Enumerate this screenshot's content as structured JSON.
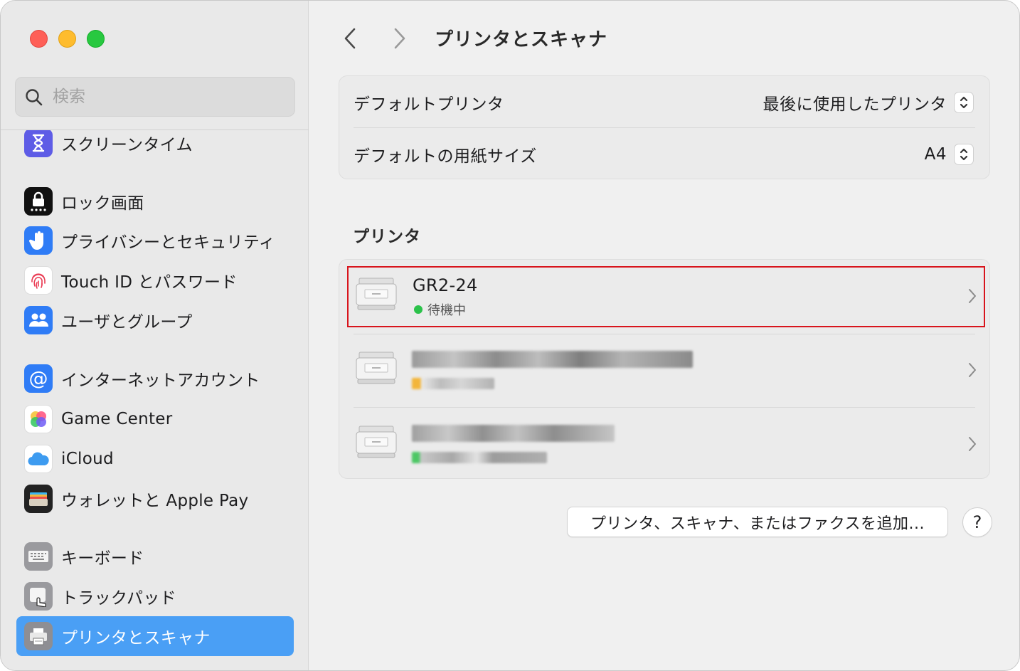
{
  "window": {
    "title": "プリンタとスキャナ"
  },
  "sidebar": {
    "search_placeholder": "検索",
    "items": [
      {
        "label": "スクリーンタイム",
        "icon": "hourglass-icon",
        "color": "#5e5ce6"
      },
      {
        "label": "ロック画面",
        "icon": "lock-screen-icon",
        "color": "#111111"
      },
      {
        "label": "プライバシーとセキュリティ",
        "icon": "hand-icon",
        "color": "#2f7cf6"
      },
      {
        "label": "Touch ID とパスワード",
        "icon": "fingerprint-icon",
        "color": "#ffffff"
      },
      {
        "label": "ユーザとグループ",
        "icon": "users-icon",
        "color": "#2f7cf6"
      },
      {
        "label": "インターネットアカウント",
        "icon": "at-icon",
        "color": "#2f7cf6"
      },
      {
        "label": "Game Center",
        "icon": "game-center-icon",
        "color": "#ffffff"
      },
      {
        "label": "iCloud",
        "icon": "cloud-icon",
        "color": "#ffffff"
      },
      {
        "label": "ウォレットと Apple Pay",
        "icon": "wallet-icon",
        "color": "#222222"
      },
      {
        "label": "キーボード",
        "icon": "keyboard-icon",
        "color": "#8e8e93"
      },
      {
        "label": "トラックパッド",
        "icon": "trackpad-icon",
        "color": "#8e8e93"
      },
      {
        "label": "プリンタとスキャナ",
        "icon": "printer-icon",
        "color": "#8e8e93",
        "selected": true
      }
    ]
  },
  "main": {
    "title": "プリンタとスキャナ",
    "defaults": [
      {
        "label": "デフォルトプリンタ",
        "value": "最後に使用したプリンタ"
      },
      {
        "label": "デフォルトの用紙サイズ",
        "value": "A4"
      }
    ],
    "printers_section_title": "プリンタ",
    "printers": [
      {
        "name": "GR2-24",
        "status": "待機中",
        "status_color": "#2bc24a"
      }
    ],
    "add_button_label": "プリンタ、スキャナ、またはファクスを追加...",
    "help_button_label": "?"
  }
}
